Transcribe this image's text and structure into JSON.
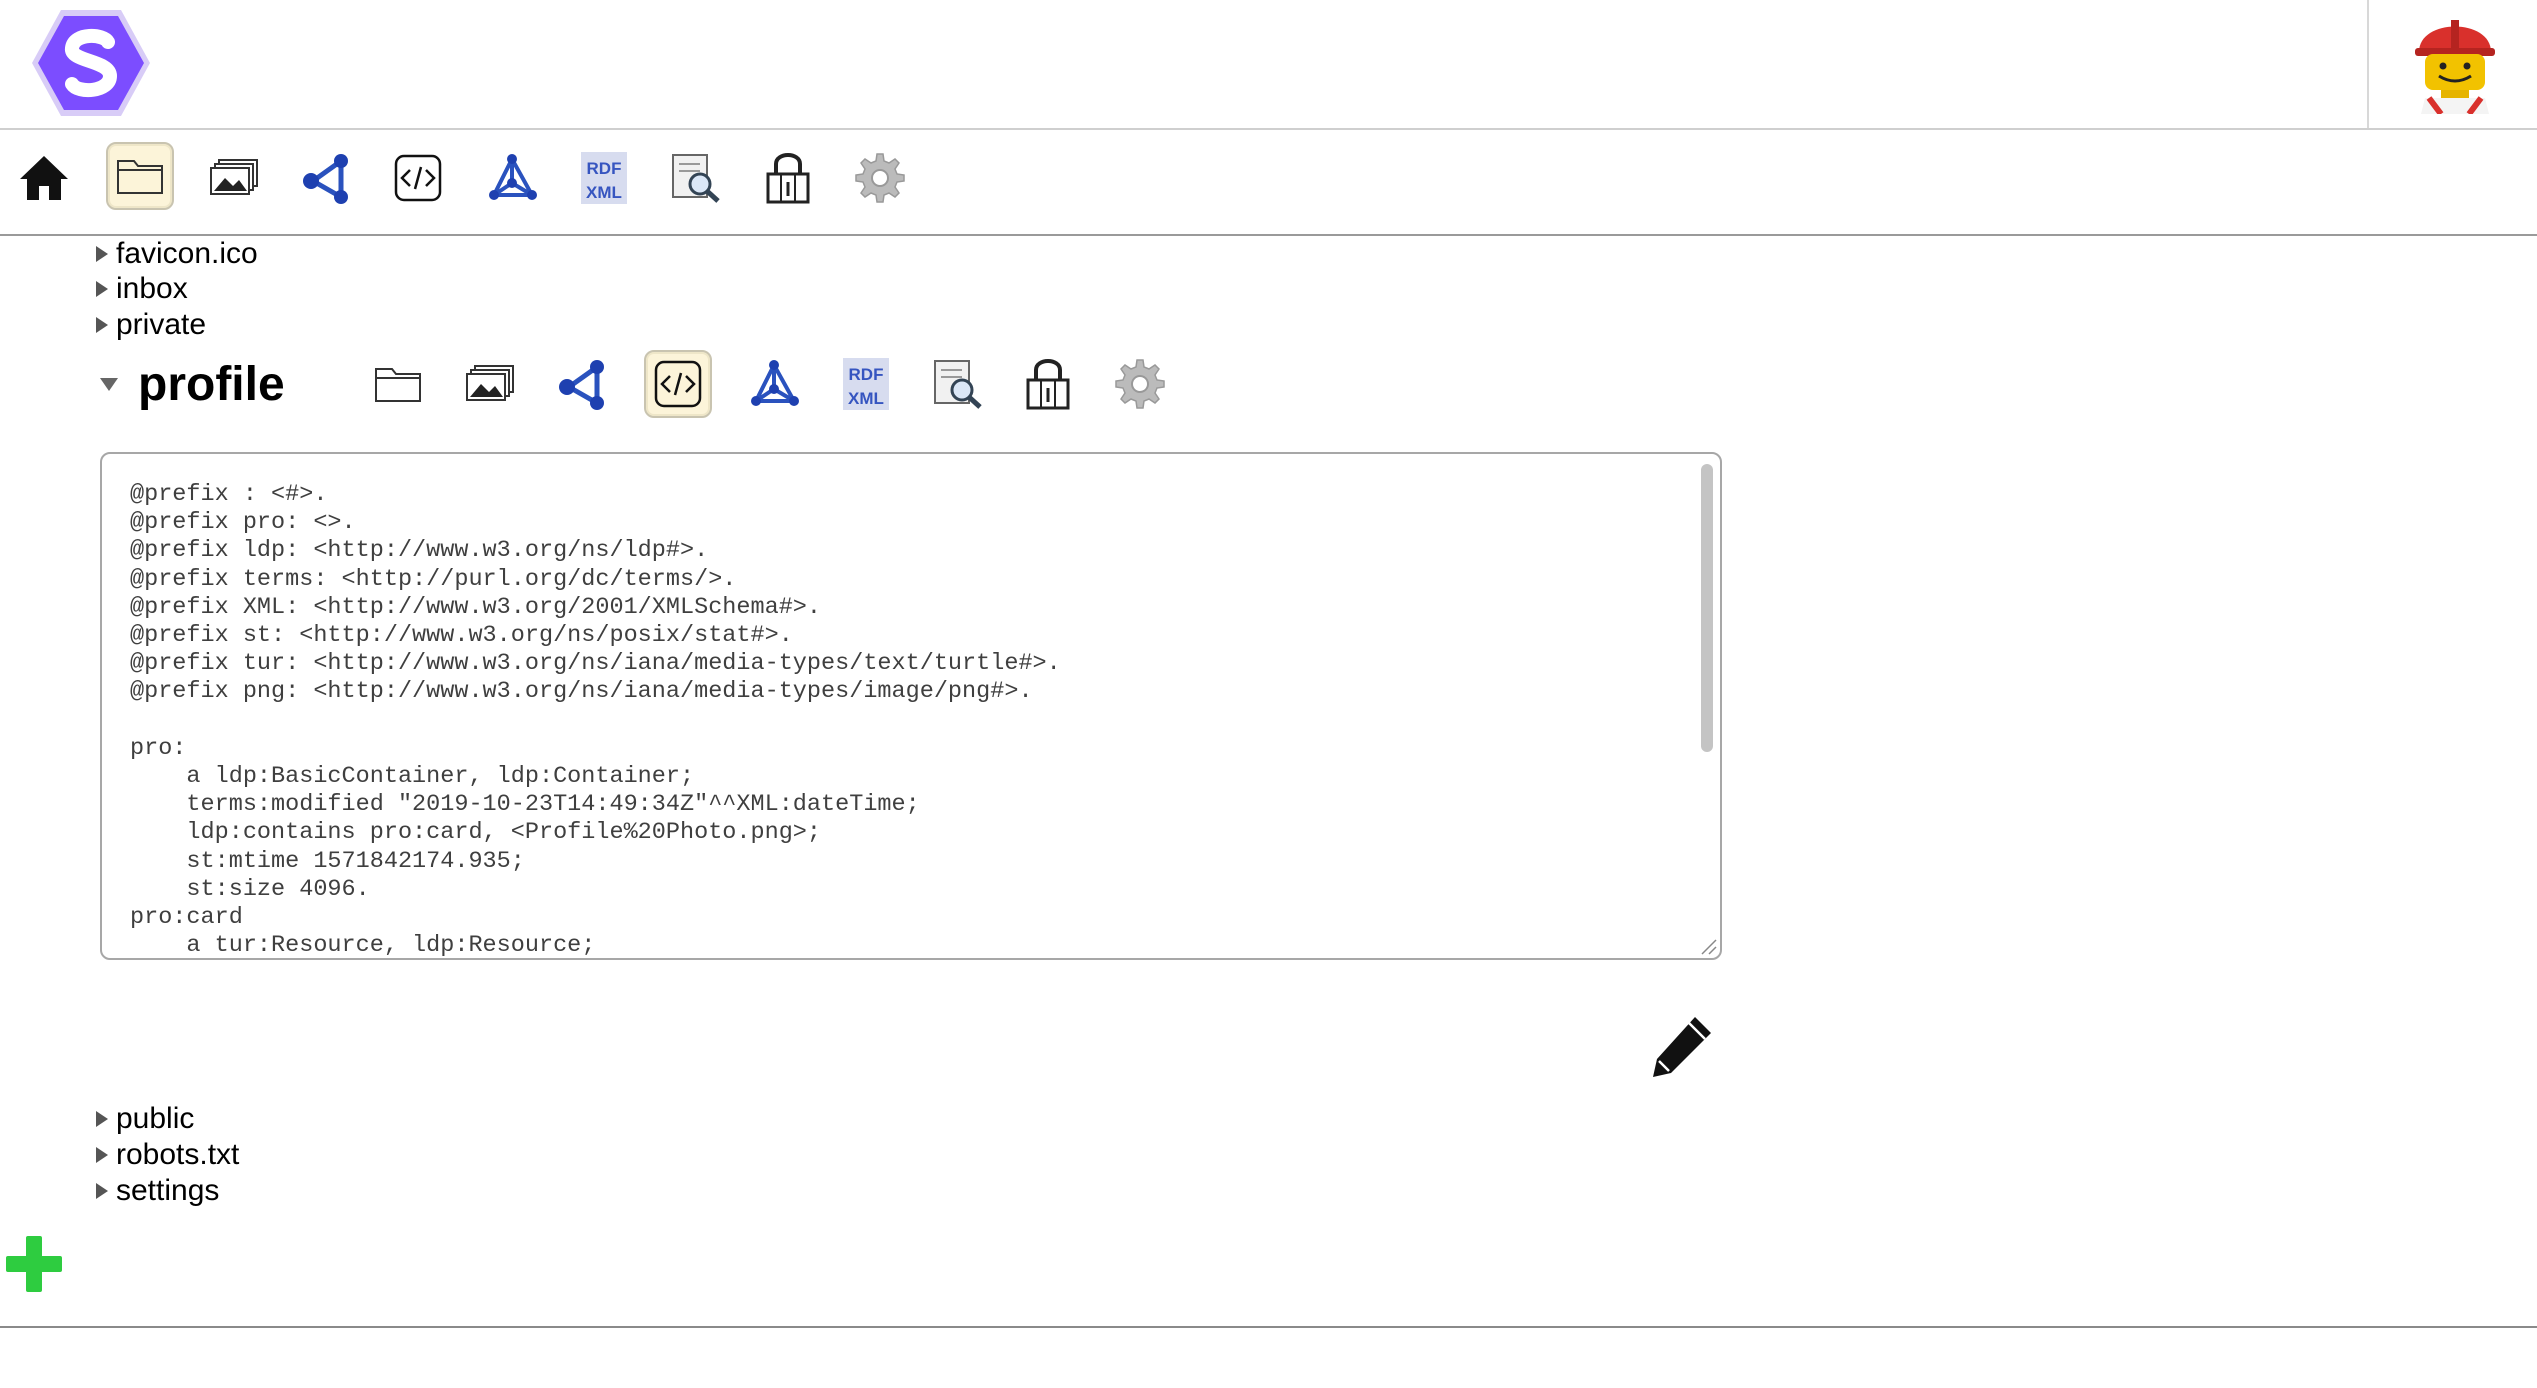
{
  "header": {
    "logo_icon": "solid-hexagon-logo-icon",
    "avatar_icon": "lego-builder-avatar-icon",
    "brand_color": "#7c4dff"
  },
  "main_toolbar": {
    "buttons": [
      {
        "icon": "home-icon"
      },
      {
        "icon": "folder-icon",
        "selected": true
      },
      {
        "icon": "image-gallery-icon"
      },
      {
        "icon": "graph-network-icon"
      },
      {
        "icon": "source-code-icon"
      },
      {
        "icon": "rdf-graph-icon"
      },
      {
        "icon": "rdf-xml-icon",
        "label": "RDF XML"
      },
      {
        "icon": "search-document-icon"
      },
      {
        "icon": "lock-icon"
      },
      {
        "icon": "gear-icon"
      }
    ]
  },
  "tree": {
    "items_before": [
      "favicon.ico",
      "inbox",
      "private"
    ],
    "expanded": {
      "label": "profile",
      "toolbar_selected": "source-code-icon",
      "editor_content": "@prefix : <#>.\n@prefix pro: <>.\n@prefix ldp: <http://www.w3.org/ns/ldp#>.\n@prefix terms: <http://purl.org/dc/terms/>.\n@prefix XML: <http://www.w3.org/2001/XMLSchema#>.\n@prefix st: <http://www.w3.org/ns/posix/stat#>.\n@prefix tur: <http://www.w3.org/ns/iana/media-types/text/turtle#>.\n@prefix png: <http://www.w3.org/ns/iana/media-types/image/png#>.\n\npro:\n    a ldp:BasicContainer, ldp:Container;\n    terms:modified \"2019-10-23T14:49:34Z\"^^XML:dateTime;\n    ldp:contains pro:card, <Profile%20Photo.png>;\n    st:mtime 1571842174.935;\n    st:size 4096.\npro:card\n    a tur:Resource, ldp:Resource;"
    },
    "items_after": [
      "public",
      "robots.txt",
      "settings"
    ]
  },
  "actions": {
    "edit_icon": "pencil-icon",
    "add_icon": "plus-icon",
    "add_color": "#2ecc40"
  }
}
